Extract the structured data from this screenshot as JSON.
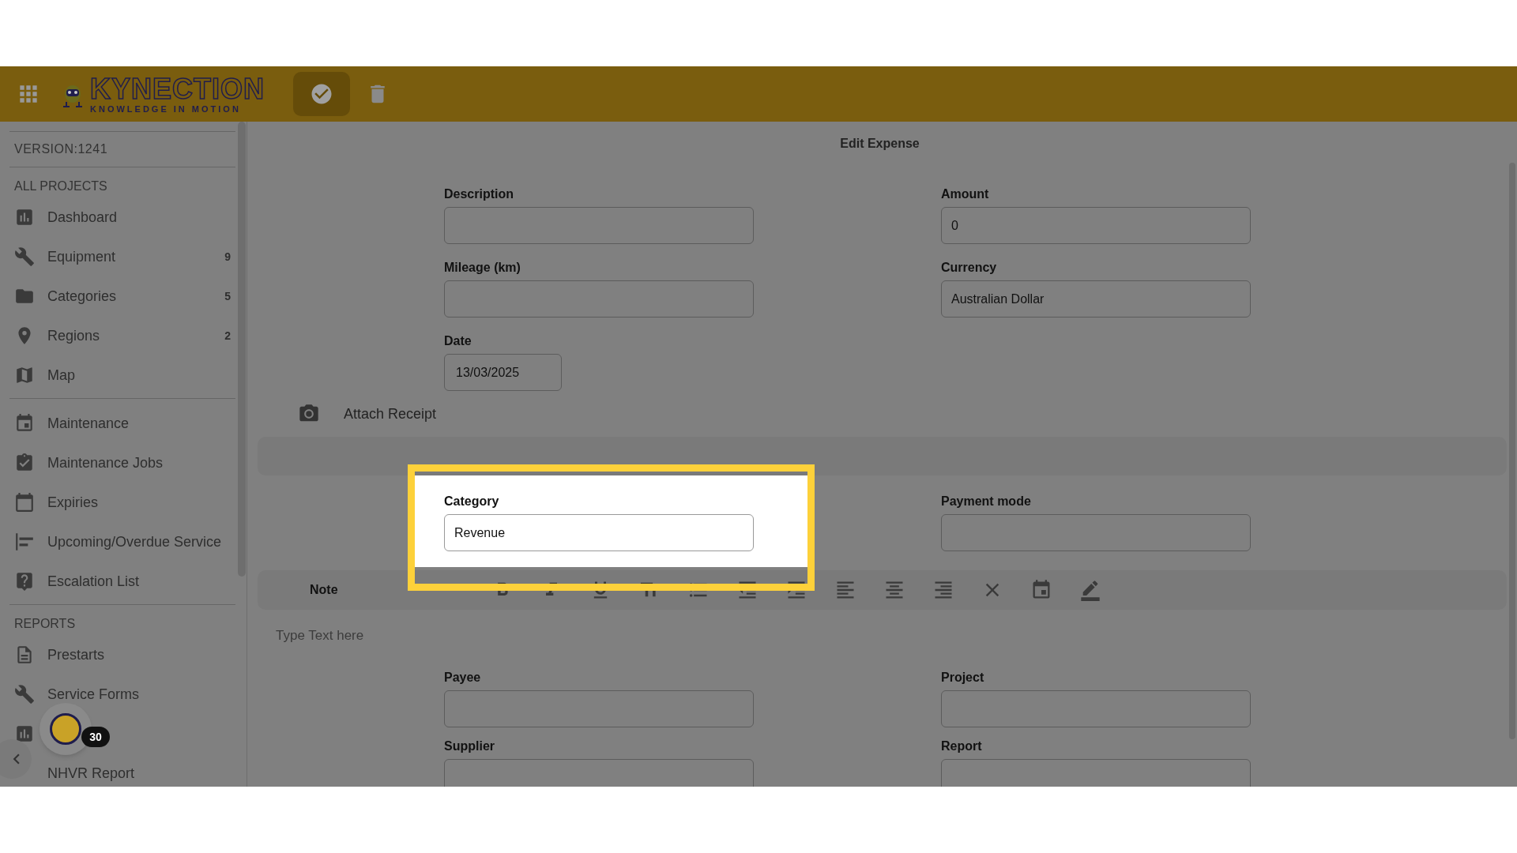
{
  "logo": {
    "name": "KYNECTION",
    "tagline": "KNOWLEDGE IN MOTION"
  },
  "sidebar": {
    "version": "VERSION:1241",
    "sections": [
      {
        "heading": "ALL PROJECTS",
        "items": [
          {
            "label": "Dashboard"
          },
          {
            "label": "Equipment",
            "count": "9"
          },
          {
            "label": "Categories",
            "count": "5"
          },
          {
            "label": "Regions",
            "count": "2"
          },
          {
            "label": "Map"
          }
        ]
      },
      {
        "items": [
          {
            "label": "Maintenance"
          },
          {
            "label": "Maintenance Jobs"
          },
          {
            "label": "Expiries"
          },
          {
            "label": "Upcoming/Overdue Service"
          },
          {
            "label": "Escalation List"
          }
        ]
      },
      {
        "heading": "REPORTS",
        "items": [
          {
            "kind": "link",
            "label": "Prestarts"
          },
          {
            "kind": "link",
            "label": "Service Forms"
          },
          {
            "kind": "icon_only"
          },
          {
            "kind": "text_only",
            "label": "NHVR Report"
          }
        ]
      }
    ],
    "notification_count": "30"
  },
  "form": {
    "title": "Edit Expense",
    "rows1": [
      {
        "left": {
          "label": "Description"
        },
        "right": {
          "label": "Amount",
          "value": "0"
        }
      },
      {
        "left": {
          "label": "Mileage (km)"
        },
        "right": {
          "label": "Currency",
          "value": "Australian Dollar"
        }
      }
    ],
    "date": {
      "label": "Date",
      "value": "13/03/2025"
    },
    "attach": "Attach Receipt",
    "category": {
      "label": "Category",
      "value": "Revenue"
    },
    "payment_mode": {
      "label": "Payment mode"
    },
    "note": {
      "label": "Note",
      "placeholder": "Type Text here"
    },
    "rows2": [
      {
        "left": {
          "label": "Payee"
        },
        "right": {
          "label": "Project"
        }
      },
      {
        "left": {
          "label": "Supplier"
        },
        "right": {
          "label": "Report"
        }
      }
    ]
  }
}
